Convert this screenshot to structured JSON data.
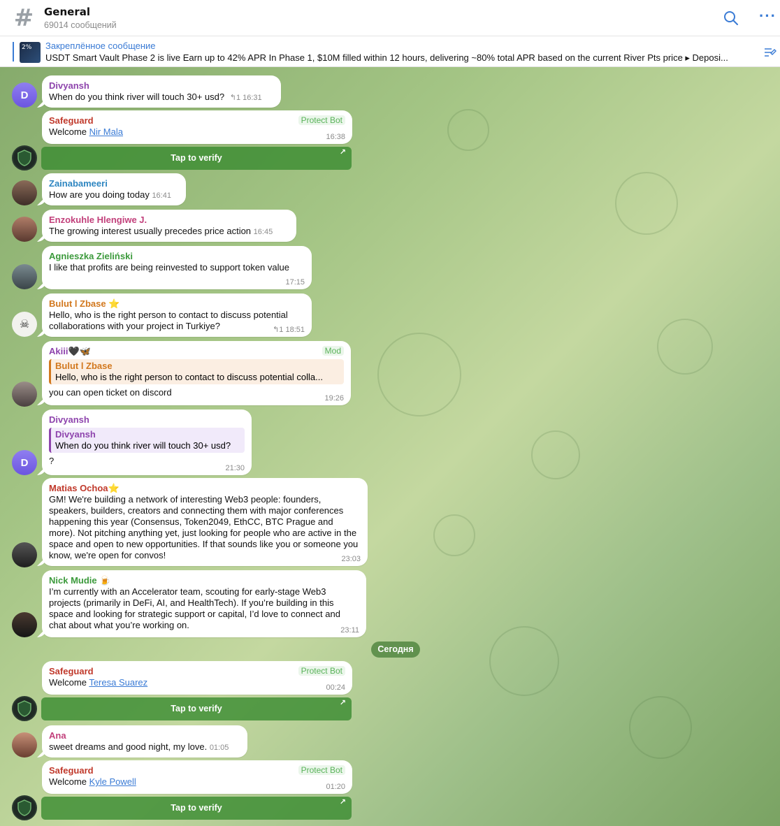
{
  "header": {
    "title": "General",
    "subtitle": "69014 сообщений"
  },
  "pinned": {
    "label": "Закреплённое сообщение",
    "thumb_text": "2%",
    "text": "USDT Smart Vault Phase 2 is live Earn up to 42% APR  In Phase 1, $10M filled within 12 hours, delivering ~80% total APR based on the current River Pts price  ▸ Deposi..."
  },
  "colors": {
    "accent": "#3a7bd5",
    "protect_badge": "#5ab35a",
    "chat_bg": "#a3c484"
  },
  "messages": [
    {
      "sender": "Divyansh",
      "sender_color": "#8e44ad",
      "text": "When do you think river will touch 30+ usd?",
      "reply_count": "1",
      "time": "16:31"
    },
    {
      "sender": "Safeguard",
      "sender_color": "#c0392b",
      "badge": "Protect Bot",
      "text_prefix": "Welcome ",
      "link": "Nir Mala",
      "time": "16:38",
      "button": "Tap to verify"
    },
    {
      "sender": "Zainabameeri",
      "sender_color": "#2e86c1",
      "text": "How are you doing today",
      "time": "16:41"
    },
    {
      "sender": "Enzokuhle Hlengiwe J.",
      "sender_color": "#c2407b",
      "text": "The growing interest usually precedes price action",
      "time": "16:45"
    },
    {
      "sender": "Agnieszka Zieliński",
      "sender_color": "#3c9a3c",
      "text": "I like that profits are being reinvested to support token value",
      "time": "17:15"
    },
    {
      "sender": "Bulut l Zbase ⭐",
      "sender_color": "#d2781e",
      "text": "Hello, who is the right person to contact to discuss potential collaborations with your project in Turkiye?",
      "reply_count": "1",
      "time": "18:51"
    },
    {
      "sender": "Akiii🖤🦋",
      "sender_color": "#8e44ad",
      "badge": "Mod",
      "quote_name": "Bulut l Zbase",
      "quote_text": "Hello, who is the right person to contact to discuss potential colla...",
      "text": "you can open ticket on discord",
      "time": "19:26"
    },
    {
      "sender": "Divyansh",
      "sender_color": "#8e44ad",
      "quote_name": "Divyansh",
      "quote_text": "When do you think river will touch 30+ usd?",
      "text": "?",
      "time": "21:30"
    },
    {
      "sender": "Matias Ochoa⭐",
      "sender_color": "#c0392b",
      "text": "GM! We're building a network of interesting Web3 people: founders, speakers, builders, creators and connecting them with major conferences happening this year (Consensus, Token2049, EthCC, BTC Prague and more). Not pitching anything yet, just looking for people who are active in the space and open to new opportunities. If that sounds like you or someone you know, we're open for convos!",
      "time": "23:03"
    },
    {
      "sender": "Nick Mudie 🍺",
      "sender_color": "#3c9a3c",
      "text": "I’m currently with an Accelerator team, scouting for early-stage Web3 projects (primarily in DeFi, AI, and HealthTech). If you’re building in this space and looking for strategic support or capital, I’d love to connect and chat about what you’re working on.",
      "time": "23:11"
    },
    {
      "sender": "Safeguard",
      "sender_color": "#c0392b",
      "badge": "Protect Bot",
      "text_prefix": "Welcome ",
      "link": "Teresa Suarez",
      "time": "00:24",
      "button": "Tap to verify"
    },
    {
      "sender": "Ana",
      "sender_color": "#c2407b",
      "text": "sweet dreams and good night, my love.",
      "time": "01:05"
    },
    {
      "sender": "Safeguard",
      "sender_color": "#c0392b",
      "badge": "Protect Bot",
      "text_prefix": "Welcome ",
      "link": "Kyle Powell",
      "time": "01:20",
      "button": "Tap to verify"
    }
  ],
  "day_divider": "Сегодня",
  "avatar_letters": {
    "divyansh": "D"
  }
}
